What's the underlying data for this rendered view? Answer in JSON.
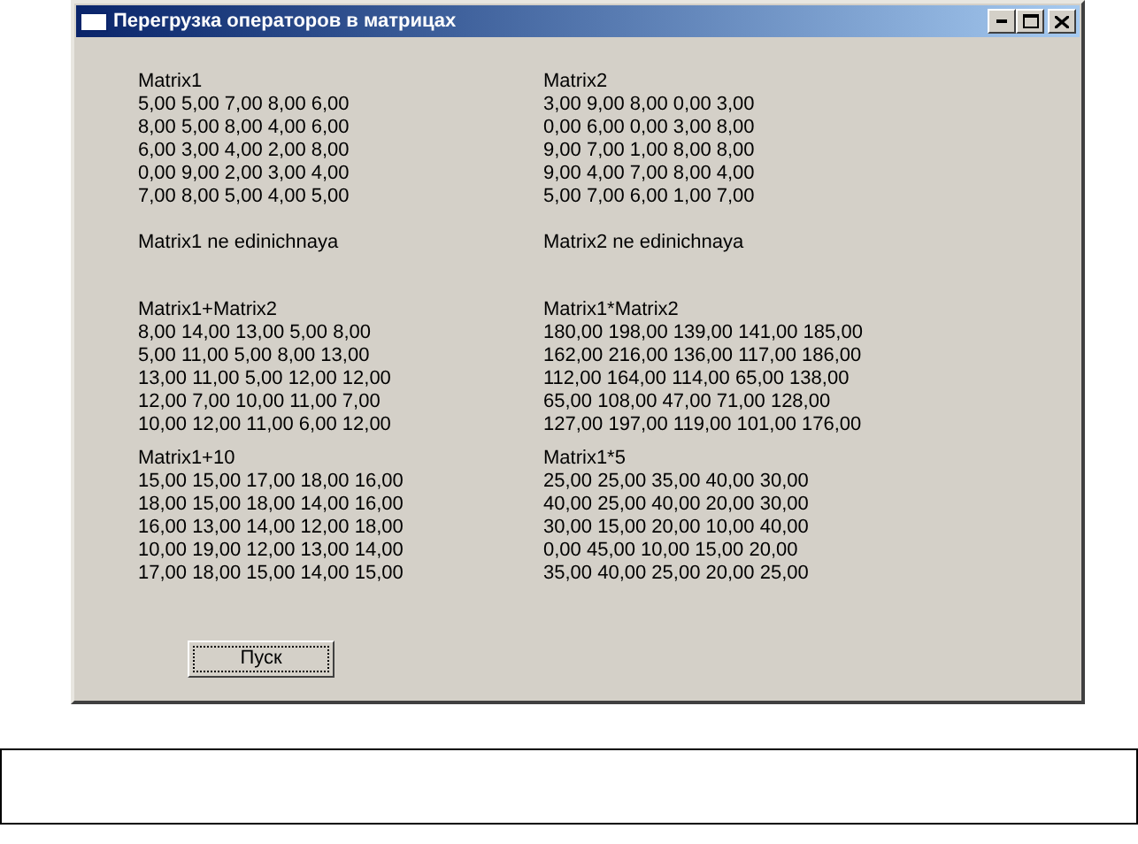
{
  "window": {
    "title": "Перегрузка операторов в матрицах"
  },
  "columns": [
    {
      "blocks": [
        {
          "kind": "matrix",
          "title": "Matrix1",
          "rows": [
            "5,00 5,00 7,00 8,00 6,00",
            "8,00 5,00 8,00 4,00 6,00",
            "6,00 3,00 4,00 2,00 8,00",
            "0,00 9,00 2,00 3,00 4,00",
            "7,00 8,00 5,00 4,00 5,00"
          ]
        },
        {
          "kind": "note",
          "text": "Matrix1 ne edinichnaya"
        },
        {
          "kind": "matrix",
          "title": "Matrix1+Matrix2",
          "rows": [
            "8,00 14,00 13,00 5,00 8,00",
            "5,00 11,00 5,00 8,00 13,00",
            "13,00 11,00 5,00 12,00 12,00",
            "12,00 7,00 10,00 11,00 7,00",
            "10,00 12,00 11,00 6,00 12,00"
          ]
        },
        {
          "kind": "matrix",
          "title": "Matrix1+10",
          "rows": [
            "15,00 15,00 17,00 18,00 16,00",
            "18,00 15,00 18,00 14,00 16,00",
            "16,00 13,00 14,00 12,00 18,00",
            "10,00 19,00 12,00 13,00 14,00",
            "17,00 18,00 15,00 14,00 15,00"
          ]
        }
      ]
    },
    {
      "blocks": [
        {
          "kind": "matrix",
          "title": "Matrix2",
          "rows": [
            "3,00 9,00 8,00 0,00 3,00",
            "0,00 6,00 0,00 3,00 8,00",
            "9,00 7,00 1,00 8,00 8,00",
            "9,00 4,00 7,00 8,00 4,00",
            "5,00 7,00 6,00 1,00 7,00"
          ]
        },
        {
          "kind": "note",
          "text": "Matrix2 ne edinichnaya"
        },
        {
          "kind": "matrix",
          "title": "Matrix1*Matrix2",
          "rows": [
            "180,00 198,00 139,00 141,00 185,00",
            "162,00 216,00 136,00 117,00 186,00",
            "112,00 164,00 114,00 65,00 138,00",
            "65,00 108,00 47,00 71,00 128,00",
            "127,00 197,00 119,00 101,00 176,00"
          ]
        },
        {
          "kind": "matrix",
          "title": "Matrix1*5",
          "rows": [
            "25,00 25,00 35,00 40,00 30,00",
            "40,00 25,00 40,00 20,00 30,00",
            "30,00 15,00 20,00 10,00 40,00",
            "0,00 45,00 10,00 15,00 20,00",
            "35,00 40,00 25,00 20,00 25,00"
          ]
        }
      ]
    }
  ],
  "button": {
    "label": "Пуск"
  }
}
